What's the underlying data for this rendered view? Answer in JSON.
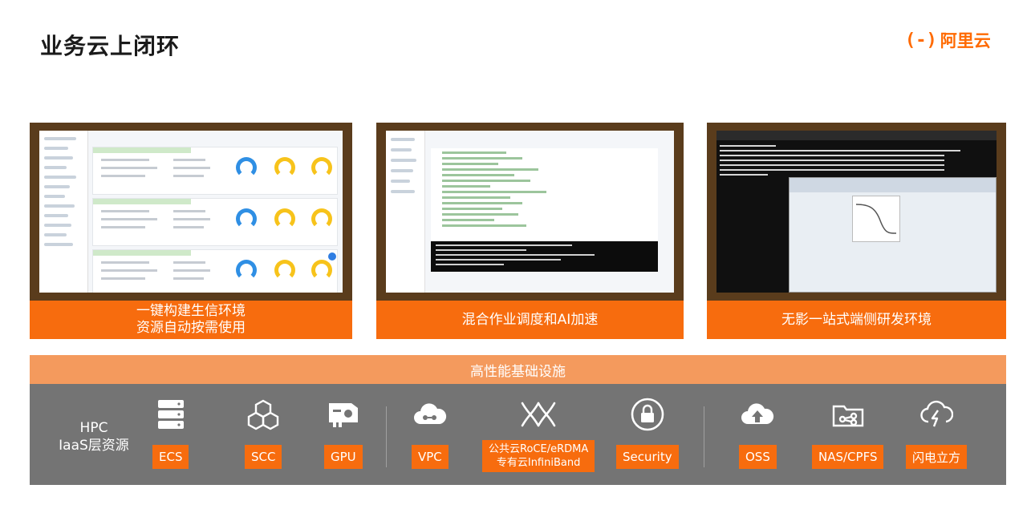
{
  "page": {
    "title": "业务云上闭环"
  },
  "brand": {
    "logo_mark": "(-)",
    "logo_text": "阿里云",
    "accent": "#f76c0e",
    "band_header_color": "#f49a5d",
    "band_color": "#747474"
  },
  "cards": [
    {
      "lines": [
        "一键构建生信环境",
        "资源自动按需使用"
      ]
    },
    {
      "lines": [
        "混合作业调度和AI加速"
      ]
    },
    {
      "lines": [
        "无影一站式端侧研发环境"
      ]
    }
  ],
  "infra": {
    "header": "高性能基础设施",
    "side_label_line1": "HPC",
    "side_label_line2": "IaaS层资源",
    "items": [
      {
        "icon": "server-icon",
        "label": "ECS"
      },
      {
        "icon": "cluster-icon",
        "label": "SCC"
      },
      {
        "icon": "gpu-card-icon",
        "label": "GPU"
      },
      {
        "icon": "cloud-network-icon",
        "label": "VPC"
      },
      {
        "icon": "rdma-network-icon",
        "label_line1": "公共云RoCE/eRDMA",
        "label_line2": "专有云InfiniBand"
      },
      {
        "icon": "security-lock-icon",
        "label": "Security"
      },
      {
        "icon": "cloud-upload-icon",
        "label": "OSS"
      },
      {
        "icon": "shared-folder-icon",
        "label": "NAS/CPFS"
      },
      {
        "icon": "cloud-lightning-icon",
        "label": "闪电立方"
      }
    ]
  }
}
